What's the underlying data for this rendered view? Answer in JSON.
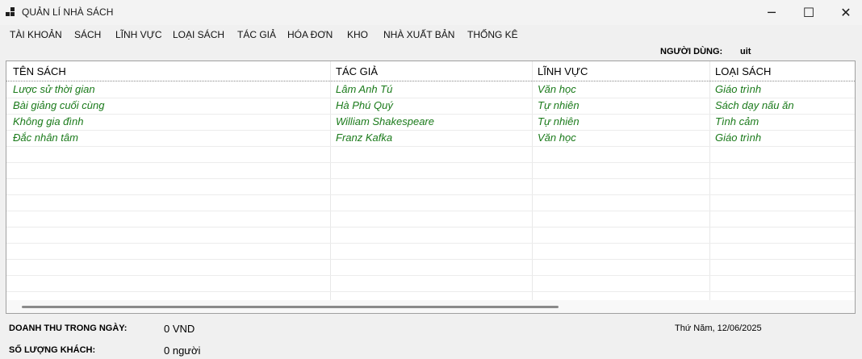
{
  "window": {
    "title": "QUẢN LÍ NHÀ SÁCH",
    "icons": {
      "app": "app-window-icon",
      "minimize": "minimize-icon",
      "maximize": "maximize-icon",
      "close": "close-icon"
    }
  },
  "menu": {
    "items": [
      {
        "label": "TÀI KHOẢN"
      },
      {
        "label": "SÁCH"
      },
      {
        "label": "LĨNH VỰC"
      },
      {
        "label": "LOẠI SÁCH"
      },
      {
        "label": "TÁC GIẢ"
      },
      {
        "label": "HÓA ĐƠN"
      },
      {
        "label": "KHO"
      },
      {
        "label": "NHÀ XUẤT BẢN"
      },
      {
        "label": "THỐNG KÊ"
      }
    ]
  },
  "user": {
    "label": "NGƯỜI DÙNG:",
    "name": "uit"
  },
  "table": {
    "columns": [
      "TÊN SÁCH",
      "TÁC GIẢ",
      "LĨNH VỰC",
      "LOẠI SÁCH"
    ],
    "rows": [
      [
        "Lược sử thời gian",
        "Lâm Anh Tú",
        "Văn học",
        "Giáo trình"
      ],
      [
        "Bài giảng cuối cùng",
        "Hà Phú Quý",
        "Tự nhiên",
        "Sách dạy nấu ăn"
      ],
      [
        "Không gia đình",
        "William Shakespeare",
        "Tự nhiên",
        "Tình cảm"
      ],
      [
        "Đắc nhân tâm",
        "Franz Kafka",
        "Văn học",
        "Giáo trình"
      ]
    ],
    "text_color": "#1a7a1a"
  },
  "footer": {
    "revenue_label": "DOANH THU TRONG NGÀY:",
    "revenue_value": "0 VND",
    "customers_label": "SỐ LƯỢNG KHÁCH:",
    "customers_value": "0 người",
    "date": "Thứ Năm, 12/06/2025"
  }
}
